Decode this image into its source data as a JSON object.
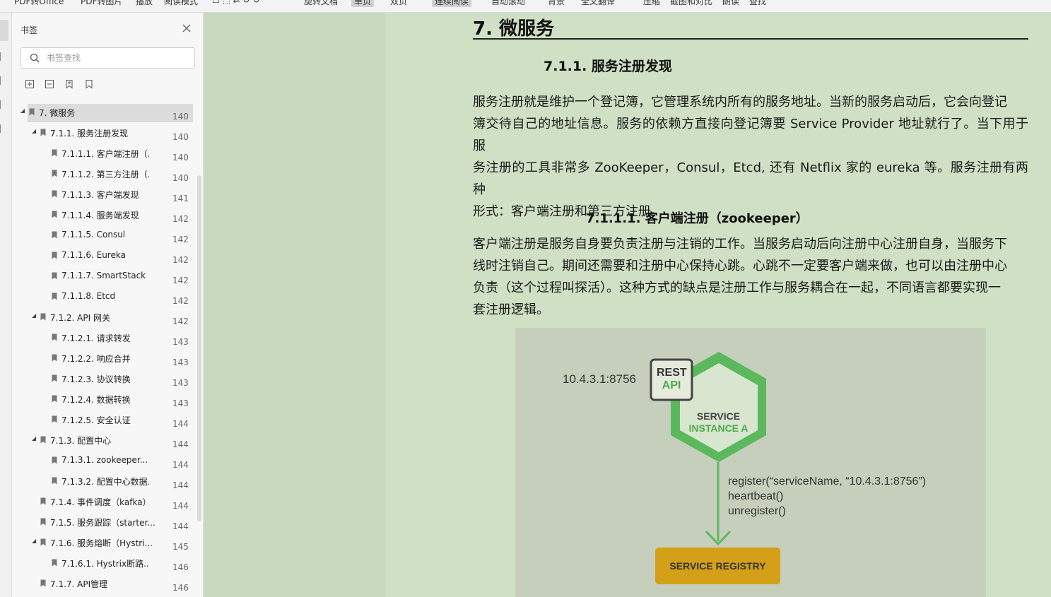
{
  "toolbar": {
    "items": [
      "PDF转Office",
      "PDF转图片",
      "播放",
      "阅读模式",
      "旋转文档",
      "单页",
      "双页",
      "连续阅读",
      "自动滚动",
      "背景",
      "全文翻译",
      "压缩",
      "截图和对比",
      "朗读",
      "查找"
    ]
  },
  "panel": {
    "title": "书签",
    "search_placeholder": "书签查找"
  },
  "bookmarks": [
    {
      "label": "7.   微服务",
      "page": "140",
      "level": 0,
      "expandable": true,
      "selected": true
    },
    {
      "label": "7.1.1. 服务注册发现",
      "page": "140",
      "level": 1,
      "expandable": true
    },
    {
      "label": "7.1.1.1. 客户端注册（...",
      "page": "140",
      "level": 2
    },
    {
      "label": "7.1.1.2. 第三方注册（...",
      "page": "140",
      "level": 2
    },
    {
      "label": "7.1.1.3. 客户端发现",
      "page": "141",
      "level": 2
    },
    {
      "label": "7.1.1.4. 服务端发现",
      "page": "142",
      "level": 2
    },
    {
      "label": "7.1.1.5. Consul",
      "page": "142",
      "level": 2
    },
    {
      "label": "7.1.1.6. Eureka",
      "page": "142",
      "level": 2
    },
    {
      "label": "7.1.1.7. SmartStack",
      "page": "142",
      "level": 2
    },
    {
      "label": "7.1.1.8. Etcd",
      "page": "142",
      "level": 2
    },
    {
      "label": "7.1.2. API 网关",
      "page": "142",
      "level": 1,
      "expandable": true
    },
    {
      "label": "7.1.2.1. 请求转发",
      "page": "143",
      "level": 2
    },
    {
      "label": "7.1.2.2. 响应合并",
      "page": "143",
      "level": 2
    },
    {
      "label": "7.1.2.3. 协议转换",
      "page": "143",
      "level": 2
    },
    {
      "label": "7.1.2.4. 数据转换",
      "page": "143",
      "level": 2
    },
    {
      "label": "7.1.2.5. 安全认证",
      "page": "144",
      "level": 2
    },
    {
      "label": "7.1.3. 配置中心",
      "page": "144",
      "level": 1,
      "expandable": true
    },
    {
      "label": "7.1.3.1. zookeeper...",
      "page": "144",
      "level": 2
    },
    {
      "label": "7.1.3.2. 配置中心数据...",
      "page": "144",
      "level": 2
    },
    {
      "label": "7.1.4. 事件调度（kafka）",
      "page": "144",
      "level": 1
    },
    {
      "label": "7.1.5. 服务跟踪（starter...",
      "page": "144",
      "level": 1
    },
    {
      "label": "7.1.6. 服务熔断（Hystri...",
      "page": "145",
      "level": 1,
      "expandable": true
    },
    {
      "label": "7.1.6.1. Hystrix断路...",
      "page": "146",
      "level": 2
    },
    {
      "label": "7.1.7. API管理",
      "page": "146",
      "level": 1
    }
  ],
  "document": {
    "h1": "7.   微服务",
    "h2": "7.1.1.  服务注册发现",
    "para1_lines": [
      " 服务注册就是维护一个登记簿，它管理系统内所有的服务地址。当新的服务启动后，它会向登记",
      "簿交待自己的地址信息。服务的依赖方直接向登记簿要 Service Provider 地址就行了。当下用于服",
      "务注册的工具非常多 ZooKeeper，Consul，Etcd, 还有 Netflix 家的 eureka 等。服务注册有两种",
      "形式：客户端注册和第三方注册。"
    ],
    "h3": "7.1.1.1.     客户端注册（zookeeper）",
    "para2_lines": [
      "客户端注册是服务自身要负责注册与注销的工作。当服务启动后向注册中心注册自身，当服务下",
      "线时注销自己。期间还需要和注册中心保持心跳。心跳不一定要客户端来做，也可以由注册中心",
      "负责（这个过程叫探活）。这种方式的缺点是注册工作与服务耦合在一起，不同语言都要实现一",
      "套注册逻辑。"
    ]
  },
  "figure": {
    "address": "10.4.3.1:8756",
    "rest_label_1": "REST",
    "rest_label_2": "API",
    "service_label_1": "SERVICE",
    "service_label_2": "INSTANCE A",
    "call_1": "register(“serviceName, “10.4.3.1:8756”)",
    "call_2": "heartbeat()",
    "call_3": "unregister()",
    "registry_label": "SERVICE REGISTRY",
    "colors": {
      "green": "#5cb85c",
      "dark_green": "#3a8a3a",
      "gold": "#d4a017",
      "bg": "#c5cfbb"
    }
  }
}
